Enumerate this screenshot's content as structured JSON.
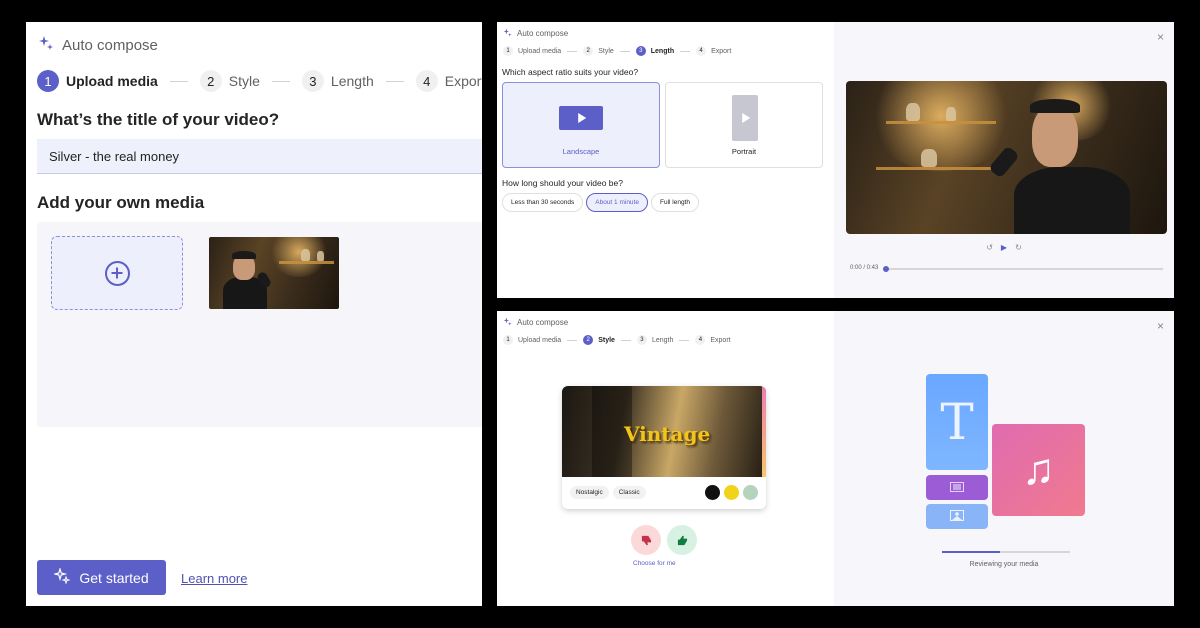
{
  "accent_color": "#5b5fc7",
  "left_panel": {
    "app_title": "Auto compose",
    "steps": [
      {
        "num": "1",
        "label": "Upload media",
        "active": true
      },
      {
        "num": "2",
        "label": "Style",
        "active": false
      },
      {
        "num": "3",
        "label": "Length",
        "active": false
      },
      {
        "num": "4",
        "label": "Export",
        "active": false
      }
    ],
    "title_heading": "What’s the title of your video?",
    "title_value": "Silver - the real money",
    "media_heading": "Add your own media",
    "get_started": "Get started",
    "learn_more": "Learn more"
  },
  "top_right": {
    "app_title": "Auto compose",
    "steps": [
      {
        "num": "1",
        "label": "Upload media"
      },
      {
        "num": "2",
        "label": "Style"
      },
      {
        "num": "3",
        "label": "Length"
      },
      {
        "num": "4",
        "label": "Export"
      }
    ],
    "active_step": 3,
    "aspect_question": "Which aspect ratio suits your video?",
    "aspect_options": [
      "Landscape",
      "Portrait"
    ],
    "aspect_selected": "Landscape",
    "length_question": "How long should your video be?",
    "length_options": [
      "Less than 30 seconds",
      "About 1 minute",
      "Full length"
    ],
    "length_selected": "About 1 minute",
    "close": "×",
    "time": "0:00 / 0:43",
    "progress": 0
  },
  "bottom_right": {
    "app_title": "Auto compose",
    "steps": [
      {
        "num": "1",
        "label": "Upload media"
      },
      {
        "num": "2",
        "label": "Style"
      },
      {
        "num": "3",
        "label": "Length"
      },
      {
        "num": "4",
        "label": "Export"
      }
    ],
    "active_step": 2,
    "style_name": "Vintage",
    "tags": [
      "Nostalgic",
      "Classic"
    ],
    "swatches": [
      "#111111",
      "#f2d21a",
      "#b5d3bd"
    ],
    "choose_for_me": "Choose for me",
    "close": "×",
    "reviewing": "Reviewing your media",
    "review_progress": 0.45,
    "tile_letter": "T",
    "music_glyph": "♫"
  }
}
